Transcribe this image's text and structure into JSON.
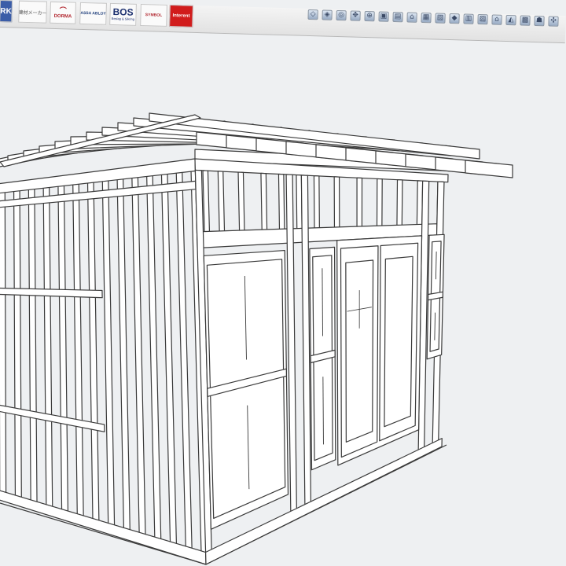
{
  "toolbar": {
    "brands": {
      "rk": "RK",
      "jp": "建材メーカー",
      "dorma": "DORMA",
      "assa": "ASSA ABLOY",
      "bos": "BOS",
      "bos_sub": "Beslag & Sikring",
      "sym": "SYMBOL",
      "interent": "Interent"
    },
    "tool_icons": [
      "select-icon",
      "camera-icon",
      "orbit-icon",
      "pan-icon",
      "zoom-icon",
      "component-icon",
      "layer-icon",
      "house-icon",
      "tile-icon",
      "cube-icon",
      "paint-icon",
      "warehouse-icon",
      "section-icon",
      "home-icon",
      "roof-icon",
      "wall-icon",
      "walker-icon",
      "tools-icon"
    ]
  },
  "colors": {
    "canvas_background": "#eef0f2",
    "model_line": "#3a3a3a",
    "model_fill": "#ffffff",
    "accent_red": "#d11c1c",
    "accent_blue": "#3b5da8"
  }
}
